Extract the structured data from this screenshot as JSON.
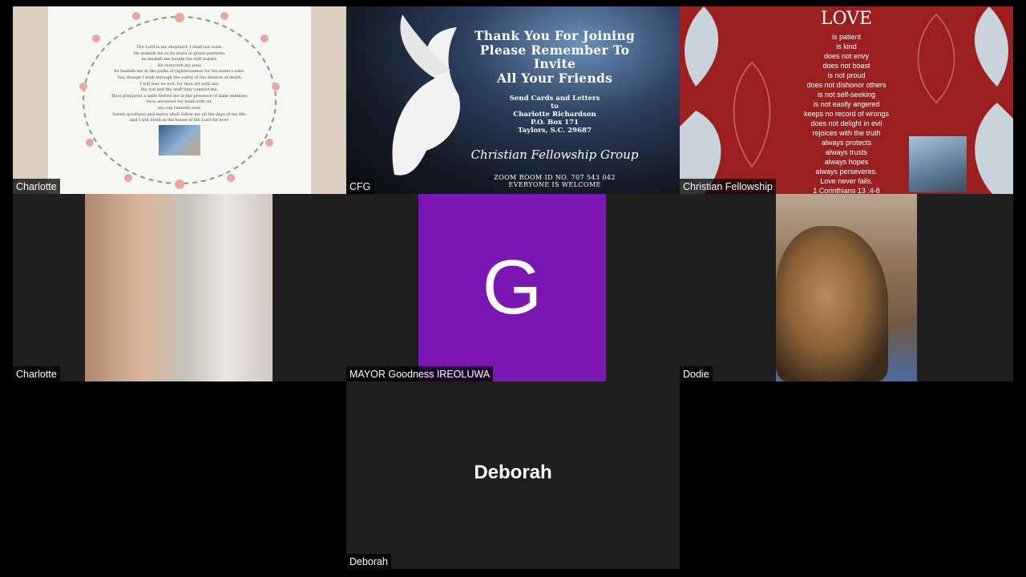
{
  "tiles": {
    "t1": {
      "name": "Charlotte",
      "psalm_lines": [
        "The Lord is my shepherd; I shall not want.",
        "He maketh me to lie down in green pastures:",
        "he leadeth me beside the still waters.",
        "He restoreth my soul:",
        "he leadeth me in the paths of righteousness for his name's sake.",
        "Yea, though I walk through the valley of the shadow of death,",
        "I will fear no evil: for thou art with me;",
        "thy rod and thy staff they comfort me.",
        "Thou preparest a table before me in the presence of mine enemies:",
        "thou anointest my head with oil;",
        "my cup runneth over.",
        "Surely goodness and mercy shall follow me all the days of my life:",
        "and I will dwell in the house of the Lord for ever."
      ]
    },
    "t2": {
      "name": "CFG",
      "headline": [
        "Thank You For Joining",
        "Please Remember To",
        "Invite",
        "All Your Friends"
      ],
      "send_lines": [
        "Send Cards and Letters",
        "to",
        "Charlotte Richardson",
        "P.O. Box 171",
        "Taylors, S.C. 29687"
      ],
      "group": "Christian Fellowship Group",
      "zoom_lines": [
        "ZOOM ROOM ID NO. 707 543 042",
        "EVERYONE IS WELCOME"
      ]
    },
    "t3": {
      "name": "Christian Fellowship",
      "title": "LOVE",
      "lines": [
        "is patient",
        "is kind",
        "does not envy",
        "does not boast",
        "is not proud",
        "does not dishonor others",
        "is not self-seeking",
        "is not easily angered",
        "keeps no record of wrongs",
        "does not delight in evil",
        "rejoices with the truth",
        "always protects",
        "always trusts",
        "always hopes",
        "always perseveres.",
        "Love never fails.",
        "1 Corinthians 13 :4-8"
      ]
    },
    "t4": {
      "name": "Charlotte"
    },
    "t5": {
      "name": "MAYOR Goodness IREOLUWA",
      "initial": "G",
      "avatar_color": "#7a16b2"
    },
    "t6": {
      "name": "Dodie"
    },
    "t7": {
      "name": "Deborah",
      "display": "Deborah"
    }
  },
  "colors": {
    "background": "#000000",
    "tile": "#1f1f1f",
    "love_red": "#9c1f1f"
  }
}
